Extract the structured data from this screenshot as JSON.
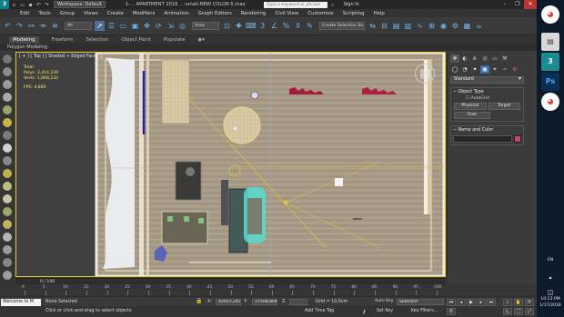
{
  "titlebar": {
    "app_icon": "3ds-max-logo",
    "workspace": "Workspace: Default",
    "document_title": "1-... APARTMENT 2016 ...-small-NEW COLOR-5.max",
    "search_placeholder": "Type a keyword or phrase",
    "sign_in": "Sign In"
  },
  "menu": [
    "Edit",
    "Tools",
    "Group",
    "Views",
    "Create",
    "Modifiers",
    "Animation",
    "Graph Editors",
    "Rendering",
    "Civil View",
    "Customize",
    "Scripting",
    "Help"
  ],
  "toolbar": {
    "filter": "All",
    "reference_coord": "View",
    "named_selection": "Create Selection Se"
  },
  "ribbon": {
    "tabs": [
      "Modeling",
      "Freeform",
      "Selection",
      "Object Paint",
      "Populate"
    ],
    "active": "Modeling",
    "panel_title": "Polygon Modeling"
  },
  "viewport": {
    "label": "[ + ] [ Top ] [ Shaded + Edged Faces ]",
    "stats": {
      "header": "Total",
      "polys_label": "Polys:",
      "polys_value": "3,414,230",
      "verts_label": "Verts:",
      "verts_value": "1,808,232",
      "fps_label": "FPS:",
      "fps_value": "4.880"
    },
    "border_color": "#e4c43b",
    "floor_color": "#a89c88"
  },
  "command_panel": {
    "category": "Standard",
    "object_type_title": "Object Type",
    "autogrid_label": "AutoGrid",
    "buttons": [
      "Physical",
      "Target",
      "Free"
    ],
    "name_color_title": "Name and Color",
    "swatch_color": "#c2467a"
  },
  "timeline": {
    "frame_label": "0 / 100",
    "ticks": [
      "0",
      "5",
      "10",
      "15",
      "20",
      "25",
      "30",
      "35",
      "40",
      "45",
      "50",
      "55",
      "60",
      "65",
      "70",
      "75",
      "80",
      "85",
      "90",
      "95",
      "100"
    ]
  },
  "status": {
    "maxscript": "Welcome to M",
    "selection": "None Selected",
    "prompt": "Click or click-and-drag to select objects",
    "x_value": "42651,243",
    "y_value": "27508,804",
    "grid": "Grid = 10,0cm",
    "add_time_tag": "Add Time Tag",
    "auto_key": "Auto Key",
    "set_key": "Set Key",
    "selected_dropdown": "Selected",
    "key_filters": "Key Filters..."
  },
  "taskbar": {
    "apps": [
      "chrome-icon",
      "file-explorer-icon",
      "3ds-max-icon",
      "photoshop-icon",
      "chrome-icon"
    ],
    "language": "EN",
    "time": "10:13 PM",
    "date": "1/17/2018"
  }
}
